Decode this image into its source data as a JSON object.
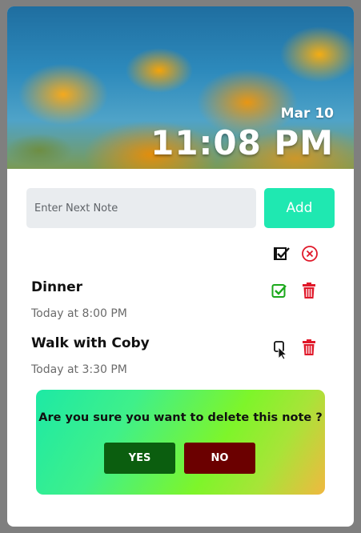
{
  "header": {
    "date": "Mar 10",
    "time": "11:08 PM"
  },
  "composer": {
    "placeholder": "Enter Next Note",
    "value": "",
    "add_label": "Add"
  },
  "toolbar": {
    "icons": [
      "check-all-icon",
      "clear-all-icon"
    ]
  },
  "notes": [
    {
      "title": "Dinner",
      "time": "Today at 8:00 PM",
      "completed": true
    },
    {
      "title": "Walk with Coby",
      "time": "Today at 3:30 PM",
      "completed": false
    }
  ],
  "confirm_dialog": {
    "message": "Are you sure you want to delete this note ?",
    "yes_label": "YES",
    "no_label": "NO"
  },
  "colors": {
    "accent": "#1fe8b1",
    "check_green": "#1aa81a",
    "delete_red": "#e0192a",
    "yes_button": "#0b5e0f",
    "no_button": "#6b0000"
  }
}
